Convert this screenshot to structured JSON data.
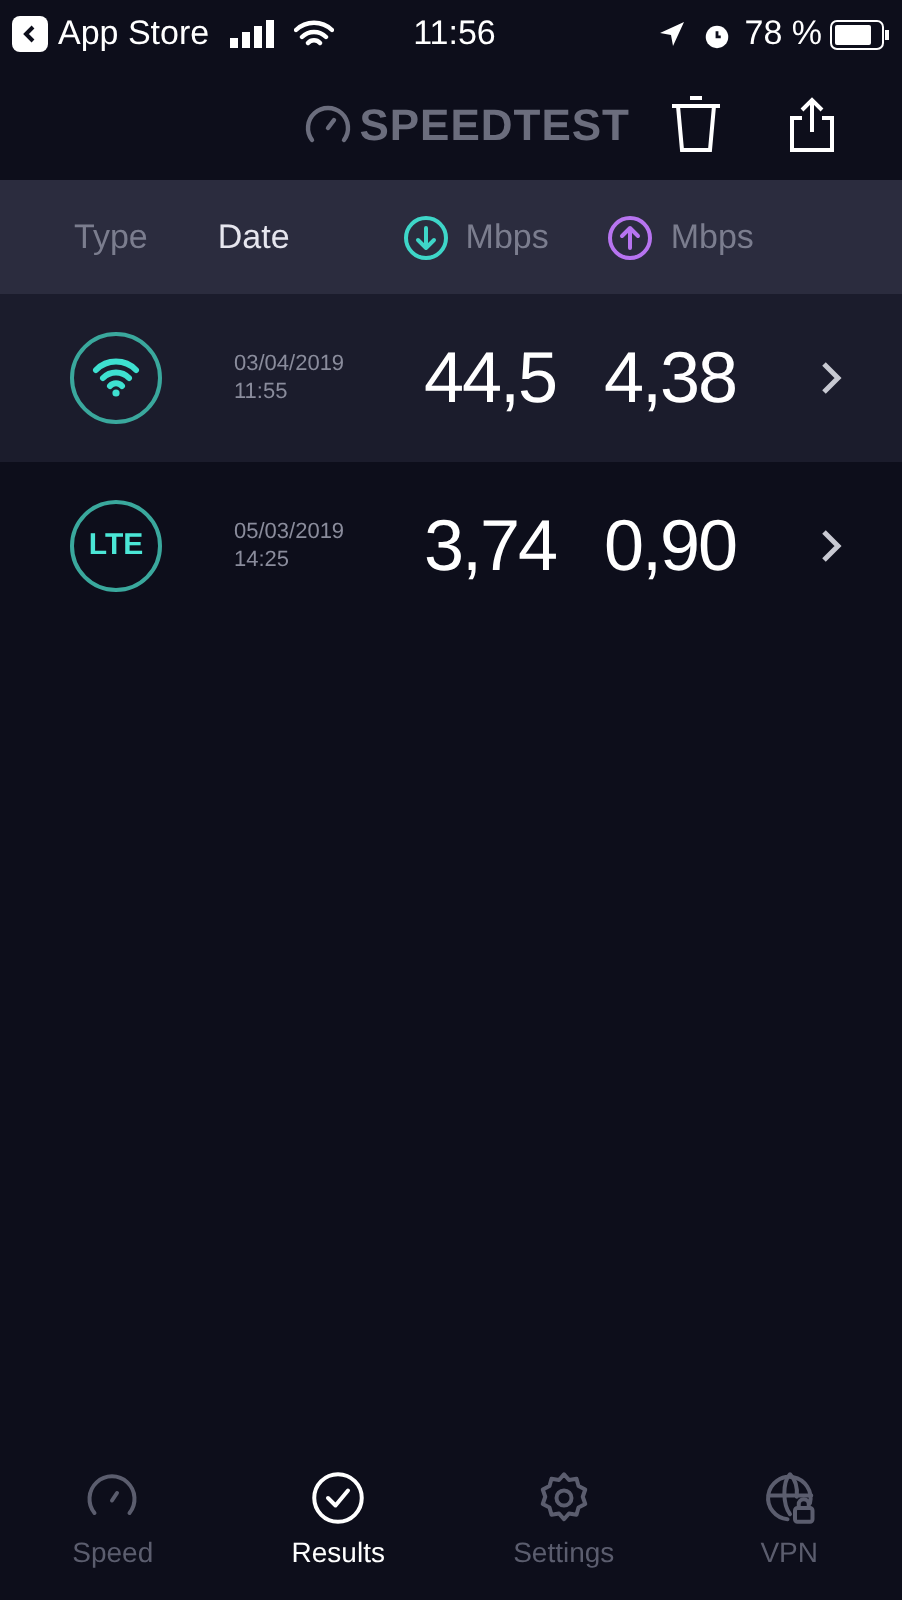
{
  "status_bar": {
    "back_label": "App Store",
    "time": "11:56",
    "battery": "78 %"
  },
  "header": {
    "logo": "SPEEDTEST"
  },
  "columns": [
    {
      "label": "Type",
      "kind": "text",
      "selected": false
    },
    {
      "label": "Date",
      "kind": "text",
      "selected": true
    },
    {
      "label": "Mbps",
      "kind": "download",
      "selected": false
    },
    {
      "label": "Mbps",
      "kind": "upload",
      "selected": false
    }
  ],
  "results": [
    {
      "kind": "wifi",
      "date": "03/04/2019",
      "time": "11:55",
      "download": "44,5",
      "upload": "4,38",
      "selected": true
    },
    {
      "kind": "lte",
      "badge": "LTE",
      "date": "05/03/2019",
      "time": "14:25",
      "download": "3,74",
      "upload": "0,90",
      "selected": false
    }
  ],
  "tabs": [
    {
      "label": "Speed",
      "kind": "speed",
      "selected": false
    },
    {
      "label": "Results",
      "kind": "results",
      "selected": true
    },
    {
      "label": "Settings",
      "kind": "settings",
      "selected": false
    },
    {
      "label": "VPN",
      "kind": "vpn",
      "selected": false
    }
  ]
}
